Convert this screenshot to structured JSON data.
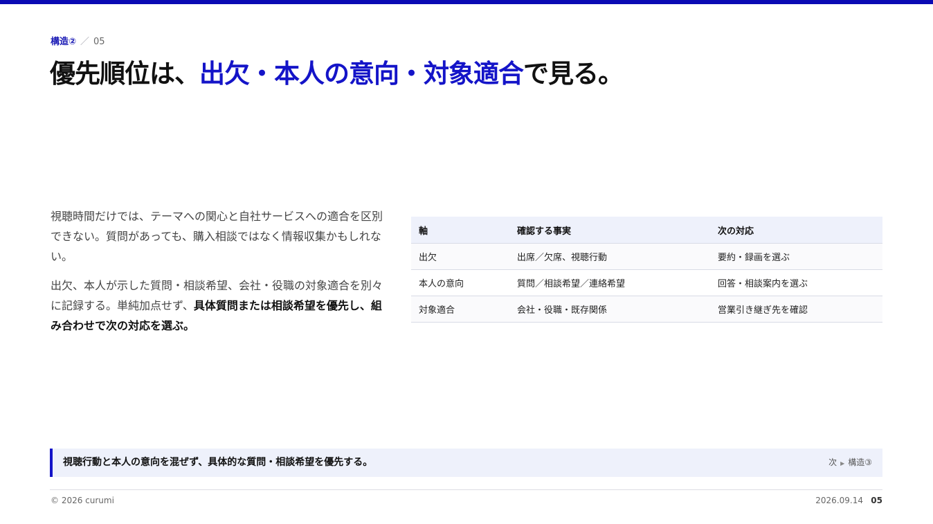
{
  "header": {
    "section": "構造②",
    "separator": "／",
    "page": "05",
    "title_prefix": "優先順位は、",
    "title_highlight": "出欠・本人の意向・対象適合",
    "title_suffix": "で見る。"
  },
  "body": {
    "para1": "視聴時間だけでは、テーマへの関心と自社サービスへの適合を区別できない。質問があっても、購入相談ではなく情報収集かもしれない。",
    "para2_plain": "出欠、本人が示した質問・相談希望、会社・役職の対象適合を別々に記録する。単純加点せず、",
    "para2_bold": "具体質問または相談希望を優先し、組み合わせで次の対応を選ぶ。"
  },
  "table": {
    "headers": [
      "軸",
      "確認する事実",
      "次の対応"
    ],
    "rows": [
      [
        "出欠",
        "出席／欠席、視聴行動",
        "要約・録画を選ぶ"
      ],
      [
        "本人の意向",
        "質問／相談希望／連絡希望",
        "回答・相談案内を選ぶ"
      ],
      [
        "対象適合",
        "会社・役職・既存関係",
        "営業引き継ぎ先を確認"
      ]
    ]
  },
  "callout": {
    "message": "視聴行動と本人の意向を混ぜず、具体的な質問・相談希望を優先する。",
    "next_label": "次",
    "next_arrow": "▶",
    "next_target": "構造③"
  },
  "footer": {
    "copyright": "© 2026 curumi",
    "date": "2026.09.14",
    "page": "05"
  },
  "colors": {
    "accent": "#1414c8",
    "top_bar": "#0a0ab4",
    "panel_bg": "#eef1fb"
  }
}
